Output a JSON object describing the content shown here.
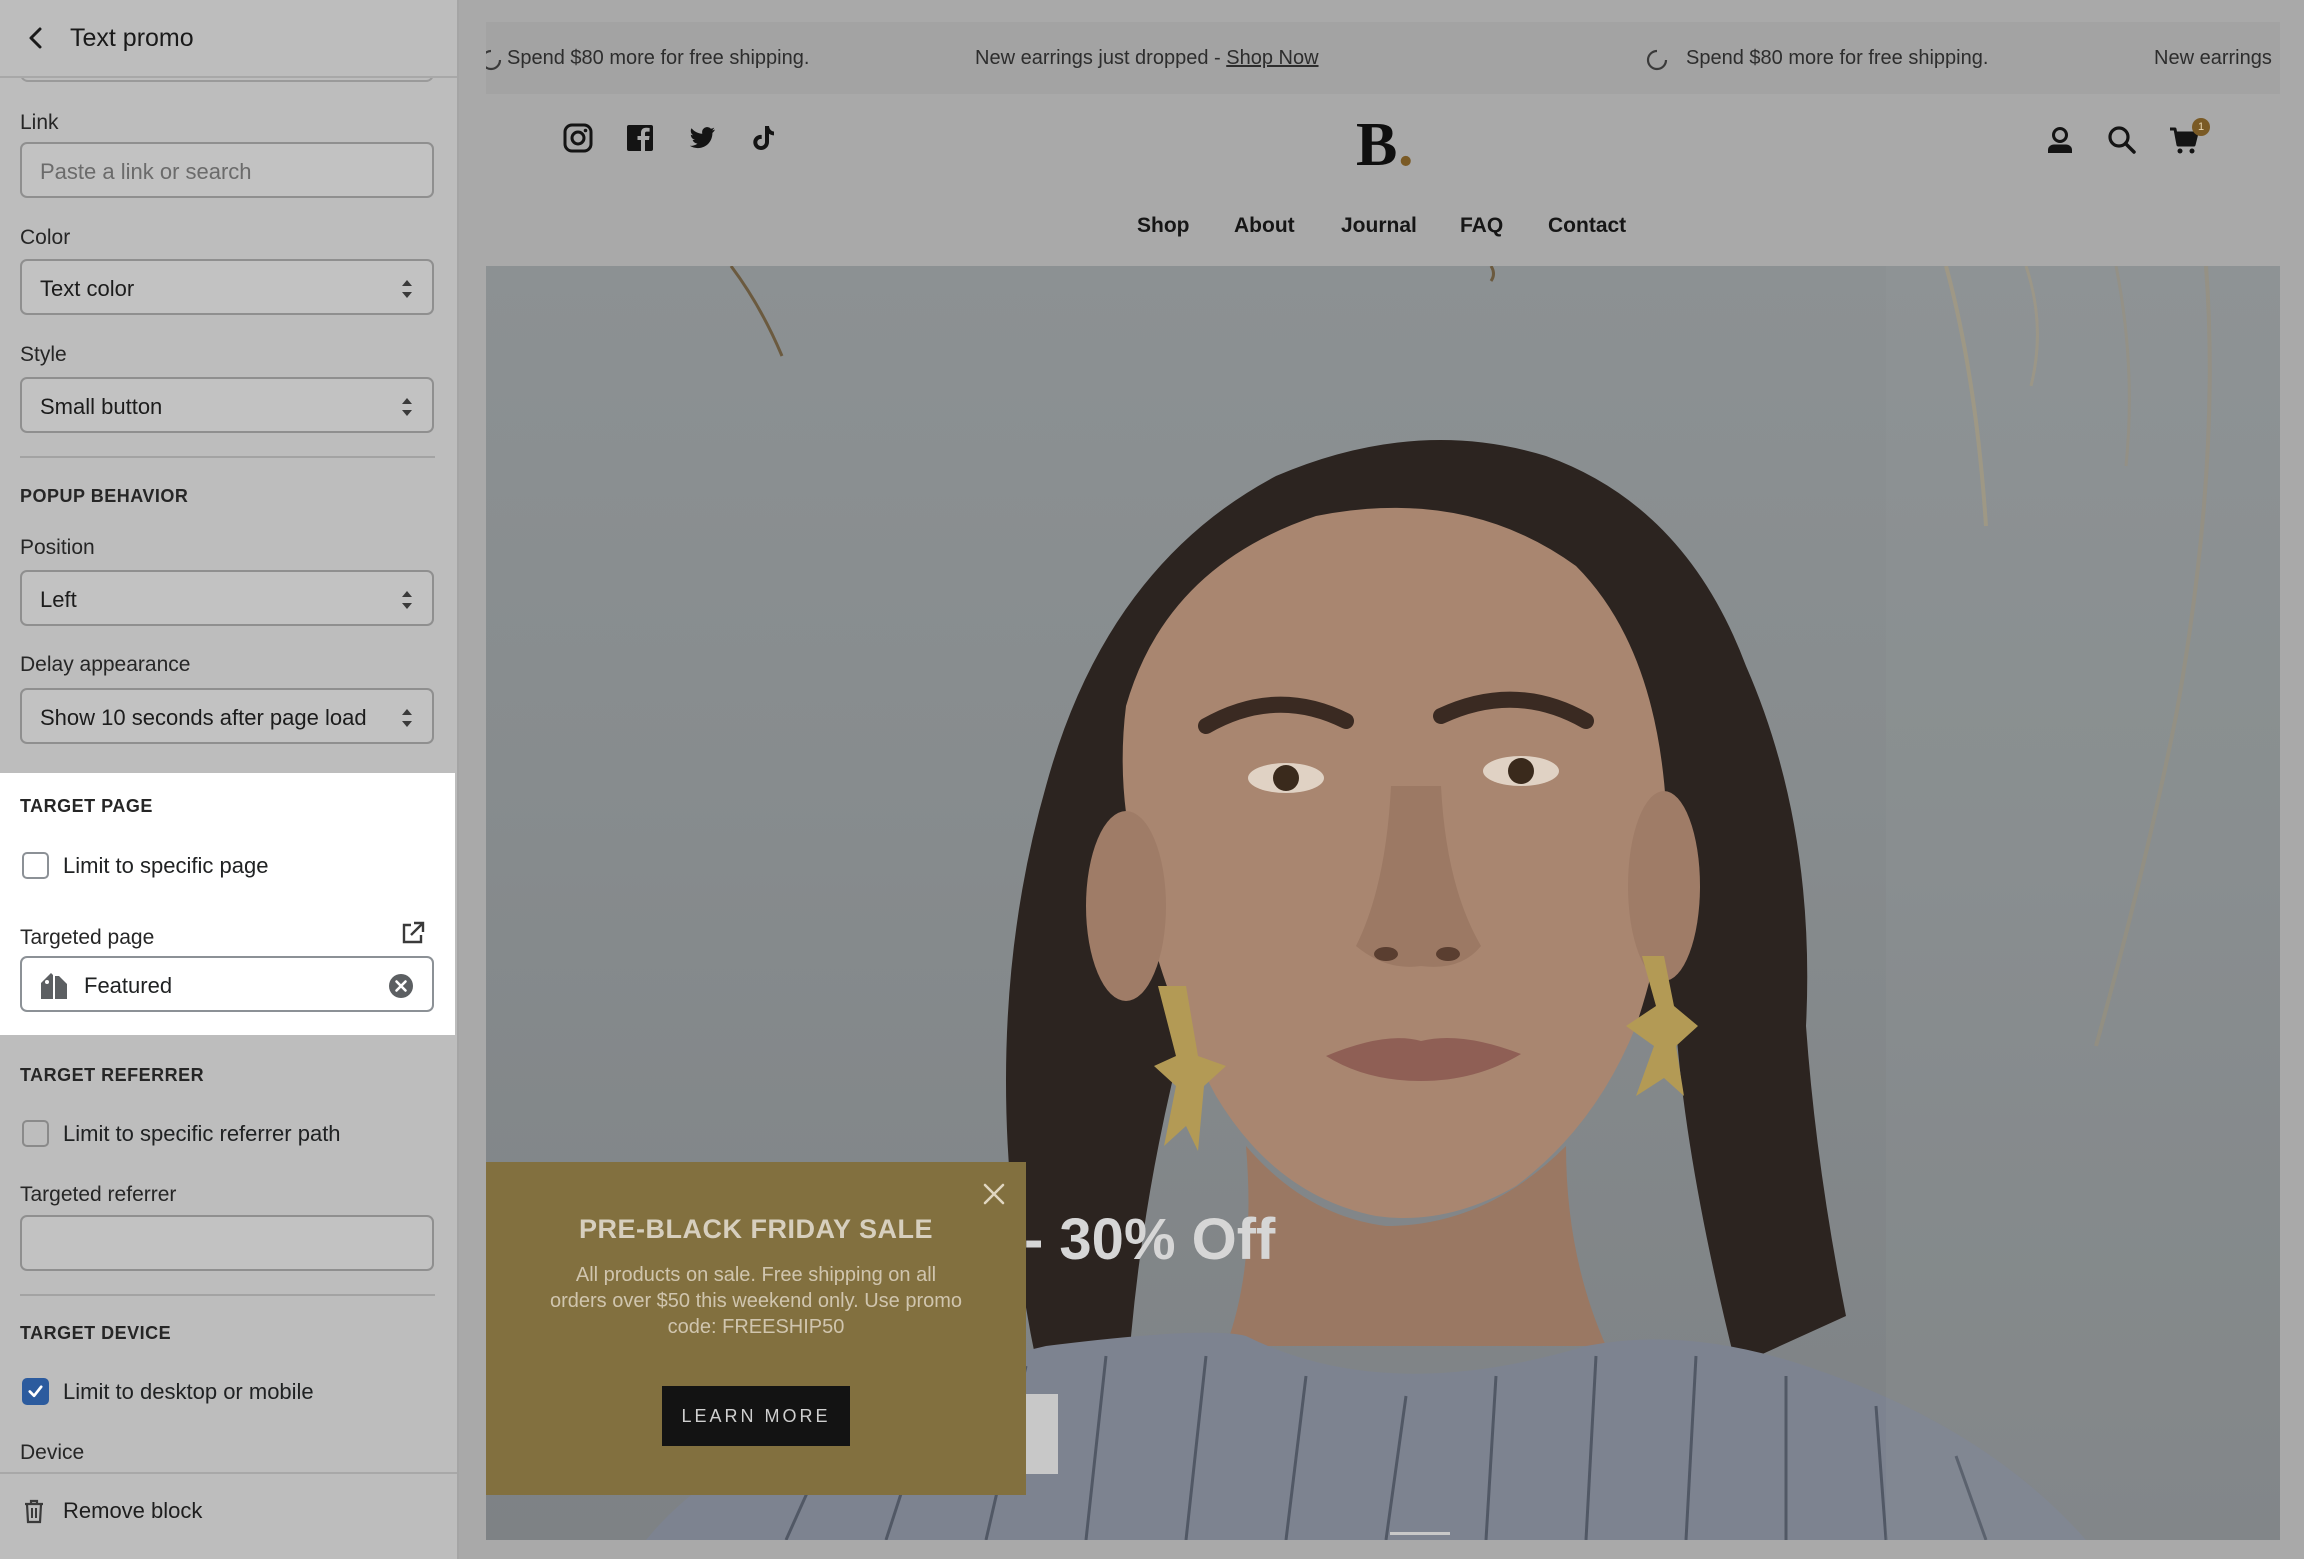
{
  "sidebar": {
    "title": "Text promo",
    "link": {
      "label": "Link",
      "placeholder": "Paste a link or search"
    },
    "color": {
      "label": "Color",
      "value": "Text color"
    },
    "style": {
      "label": "Style",
      "value": "Small button"
    },
    "popup_behavior": {
      "section_title": "POPUP BEHAVIOR",
      "position": {
        "label": "Position",
        "value": "Left"
      },
      "delay": {
        "label": "Delay appearance",
        "value": "Show 10 seconds after page load"
      }
    },
    "target_page": {
      "section_title": "TARGET PAGE",
      "checkbox_label": "Limit to specific page",
      "checked": false,
      "targeted_label": "Targeted page",
      "targeted_value": "Featured"
    },
    "target_referrer": {
      "section_title": "TARGET REFERRER",
      "checkbox_label": "Limit to specific referrer path",
      "checked": false,
      "targeted_label": "Targeted referrer",
      "targeted_value": ""
    },
    "target_device": {
      "section_title": "TARGET DEVICE",
      "checkbox_label": "Limit to desktop or mobile",
      "checked": true,
      "device_label": "Device"
    },
    "footer": {
      "remove_label": "Remove block"
    }
  },
  "preview": {
    "announcements": [
      "Spend $80 more for free shipping.",
      "New earrings just dropped - ",
      "Shop Now",
      "Spend $80 more for free shipping.",
      "New earrings"
    ],
    "logo": "B",
    "logo_dot": ".",
    "cart_count": "1",
    "nav": [
      "Shop",
      "About",
      "Journal",
      "FAQ",
      "Contact"
    ],
    "hero": {
      "headline": "- 30% Off"
    },
    "popup": {
      "title": "PRE-BLACK FRIDAY SALE",
      "body": "All products on sale. Free shipping on all orders over $50 this weekend only. Use promo code: FREESHIP50",
      "button": "LEARN MORE"
    }
  },
  "colors": {
    "accent_checkbox": "#2c5b9e",
    "popup_bg": "#82703f",
    "brand_dot": "#7a5a25"
  }
}
